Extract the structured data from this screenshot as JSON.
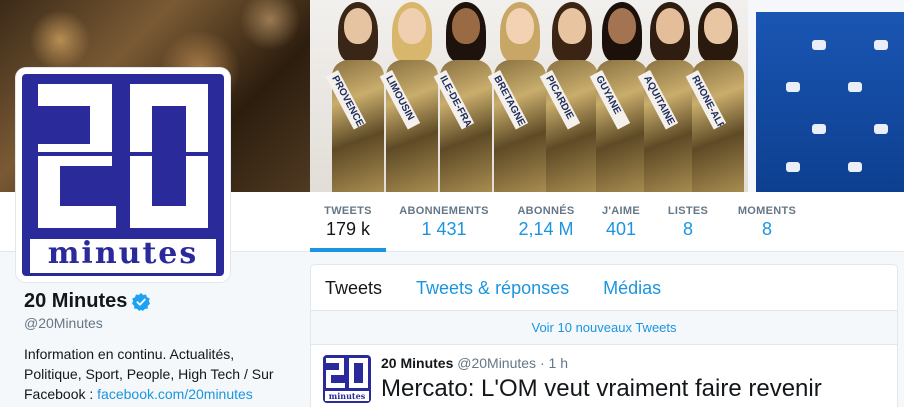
{
  "profile": {
    "name": "20 Minutes",
    "handle": "@20Minutes",
    "bio_text": "Information en continu. Actualités, Politique, Sport, People, High Tech / Sur Facebook : ",
    "bio_link": "facebook.com/20minutes",
    "avatar_digits": "20",
    "avatar_word": "minutes"
  },
  "banner": {
    "sashes": [
      "PROVENCE",
      "LIMOUSIN",
      "ILE-DE-FRANCE",
      "BRETAGNE",
      "PICARDIE",
      "GUYANE",
      "AQUITAINE",
      "RHONE-ALPES"
    ]
  },
  "stats": [
    {
      "label": "TWEETS",
      "value": "179 k"
    },
    {
      "label": "ABONNEMENTS",
      "value": "1 431"
    },
    {
      "label": "ABONNÉS",
      "value": "2,14 M"
    },
    {
      "label": "J'AIME",
      "value": "401"
    },
    {
      "label": "LISTES",
      "value": "8"
    },
    {
      "label": "MOMENTS",
      "value": "8"
    }
  ],
  "timeline": {
    "tabs": [
      "Tweets",
      "Tweets & réponses",
      "Médias"
    ],
    "new_tweets": "Voir 10 nouveaux Tweets"
  },
  "tweet": {
    "name": "20 Minutes",
    "handle": "@20Minutes",
    "separator": "·",
    "time": "1 h",
    "text": "Mercato: L'OM veut vraiment faire revenir"
  },
  "colors": {
    "brand_blue": "#2b2a9b",
    "link_blue": "#1b95e0",
    "verified": "#1da1f2"
  }
}
